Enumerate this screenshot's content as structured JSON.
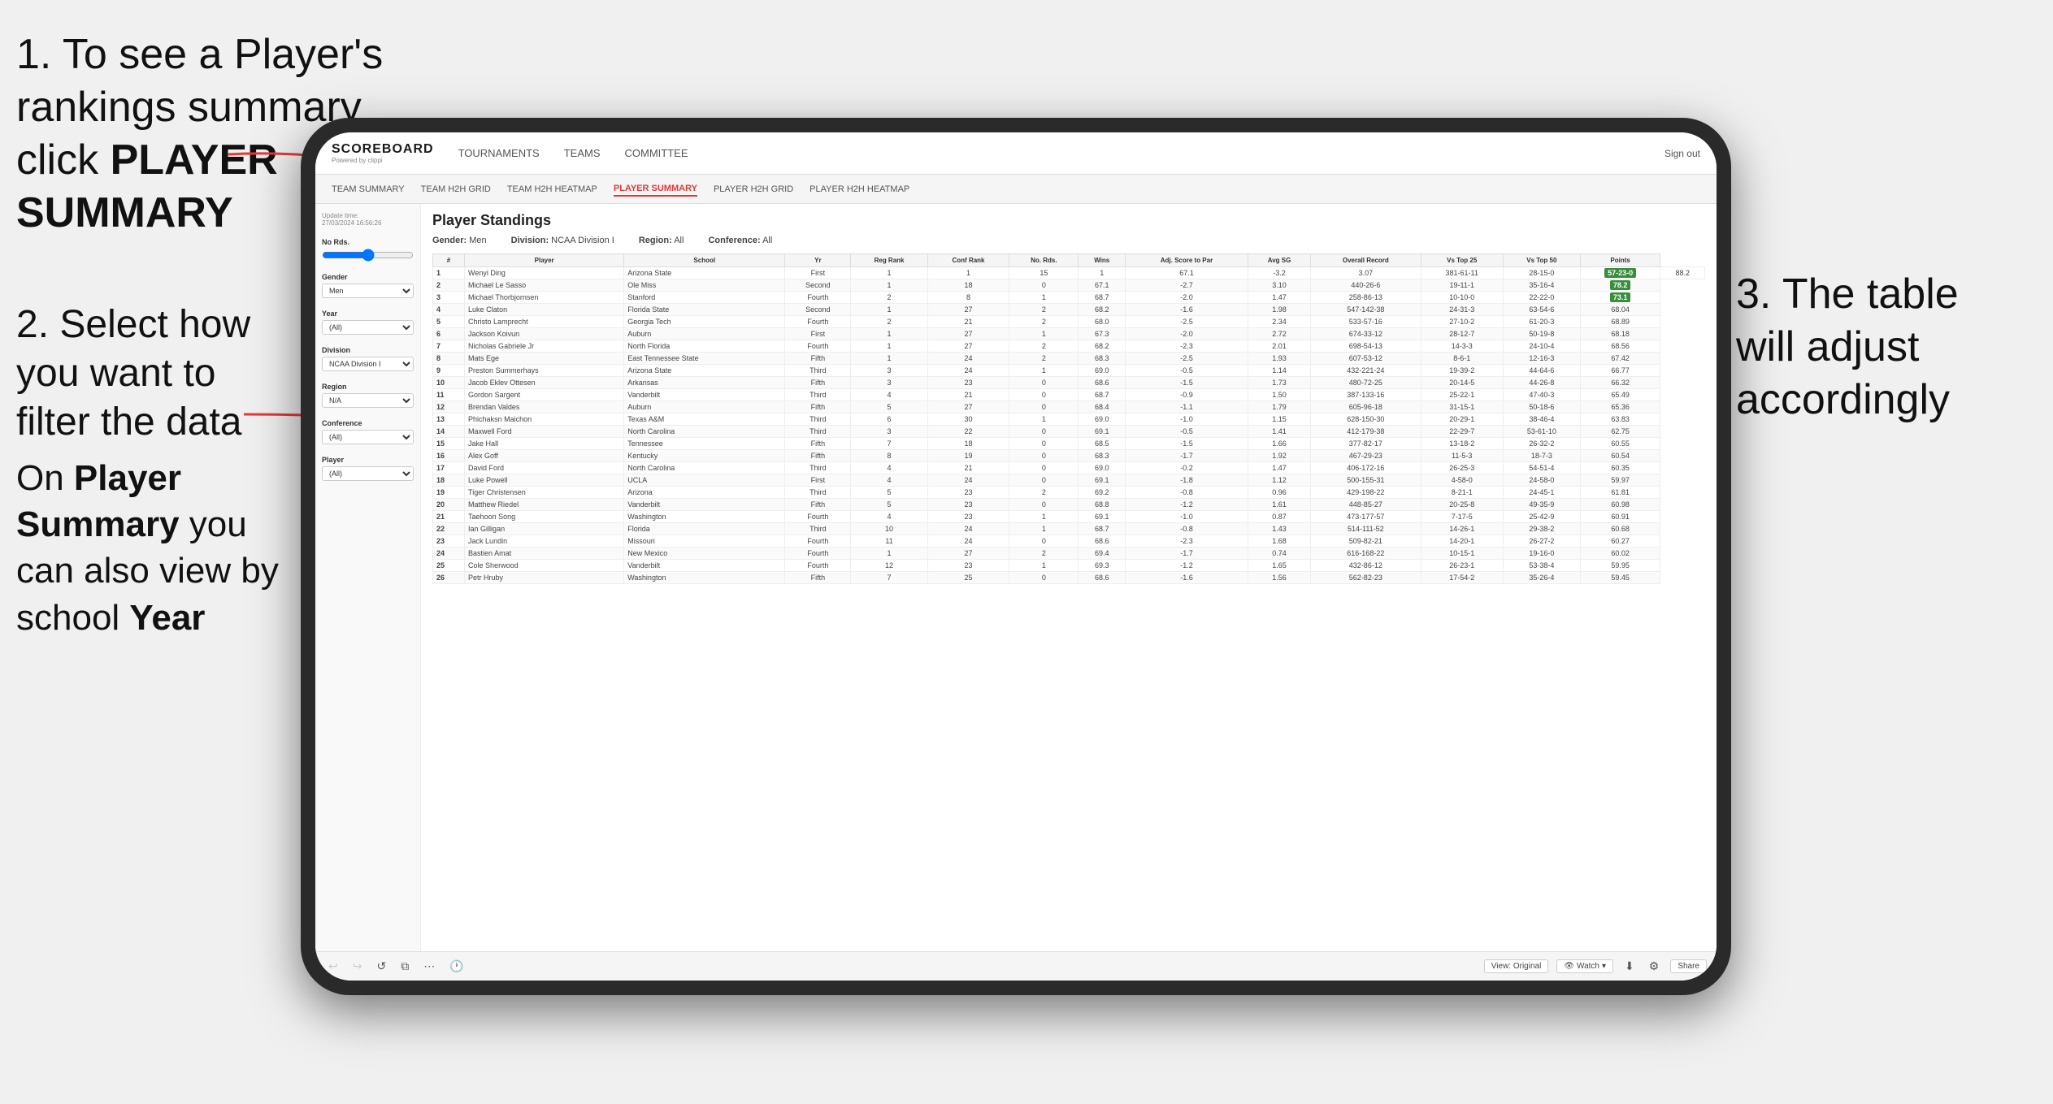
{
  "instructions": {
    "step1": "1. To see a Player's rankings summary click ",
    "step1_bold": "PLAYER SUMMARY",
    "step2_title": "2. Select how you want to filter the data",
    "step3_title": "3. The table will adjust accordingly",
    "bottom_note_pre": "On ",
    "bottom_note_bold1": "Player Summary",
    "bottom_note_mid": " you can also view by school ",
    "bottom_note_bold2": "Year"
  },
  "nav": {
    "logo": "SCOREBOARD",
    "logo_sub": "Powered by clippi",
    "items": [
      "TOURNAMENTS",
      "TEAMS",
      "COMMITTEE"
    ],
    "sign_out": "Sign out"
  },
  "sub_nav": {
    "items": [
      "TEAM SUMMARY",
      "TEAM H2H GRID",
      "TEAM H2H HEATMAP",
      "PLAYER SUMMARY",
      "PLAYER H2H GRID",
      "PLAYER H2H HEATMAP"
    ],
    "active": "PLAYER SUMMARY"
  },
  "sidebar": {
    "update_label": "Update time:",
    "update_time": "27/03/2024 16:56:26",
    "no_rds_label": "No Rds.",
    "gender_label": "Gender",
    "gender_value": "Men",
    "year_label": "Year",
    "year_value": "(All)",
    "division_label": "Division",
    "division_value": "NCAA Division I",
    "region_label": "Region",
    "region_value": "N/A",
    "conference_label": "Conference",
    "conference_value": "(All)",
    "player_label": "Player",
    "player_value": "(All)"
  },
  "table": {
    "title": "Player Standings",
    "filters": {
      "gender_label": "Gender:",
      "gender_value": "Men",
      "division_label": "Division:",
      "division_value": "NCAA Division I",
      "region_label": "Region:",
      "region_value": "All",
      "conference_label": "Conference:",
      "conference_value": "All"
    },
    "columns": [
      "#",
      "Player",
      "School",
      "Yr",
      "Reg Rank",
      "Conf Rank",
      "No. Rds.",
      "Wins",
      "Adj. Score to Par",
      "Avg SG",
      "Overall Record",
      "Vs Top 25",
      "Vs Top 50",
      "Points"
    ],
    "rows": [
      [
        "1",
        "Wenyi Ding",
        "Arizona State",
        "First",
        "1",
        "1",
        "15",
        "1",
        "67.1",
        "-3.2",
        "3.07",
        "381-61-11",
        "28-15-0",
        "57-23-0",
        "88.2"
      ],
      [
        "2",
        "Michael Le Sasso",
        "Ole Miss",
        "Second",
        "1",
        "18",
        "0",
        "67.1",
        "-2.7",
        "3.10",
        "440-26-6",
        "19-11-1",
        "35-16-4",
        "78.2"
      ],
      [
        "3",
        "Michael Thorbjornsen",
        "Stanford",
        "Fourth",
        "2",
        "8",
        "1",
        "68.7",
        "-2.0",
        "1.47",
        "258-86-13",
        "10-10-0",
        "22-22-0",
        "73.1"
      ],
      [
        "4",
        "Luke Claton",
        "Florida State",
        "Second",
        "1",
        "27",
        "2",
        "68.2",
        "-1.6",
        "1.98",
        "547-142-38",
        "24-31-3",
        "63-54-6",
        "68.04"
      ],
      [
        "5",
        "Christo Lamprecht",
        "Georgia Tech",
        "Fourth",
        "2",
        "21",
        "2",
        "68.0",
        "-2.5",
        "2.34",
        "533-57-16",
        "27-10-2",
        "61-20-3",
        "68.89"
      ],
      [
        "6",
        "Jackson Koivun",
        "Auburn",
        "First",
        "1",
        "27",
        "1",
        "67.3",
        "-2.0",
        "2.72",
        "674-33-12",
        "28-12-7",
        "50-19-8",
        "68.18"
      ],
      [
        "7",
        "Nicholas Gabriele Jr",
        "North Florida",
        "Fourth",
        "1",
        "27",
        "2",
        "68.2",
        "-2.3",
        "2.01",
        "698-54-13",
        "14-3-3",
        "24-10-4",
        "68.56"
      ],
      [
        "8",
        "Mats Ege",
        "East Tennessee State",
        "Fifth",
        "1",
        "24",
        "2",
        "68.3",
        "-2.5",
        "1.93",
        "607-53-12",
        "8-6-1",
        "12-16-3",
        "67.42"
      ],
      [
        "9",
        "Preston Summerhays",
        "Arizona State",
        "Third",
        "3",
        "24",
        "1",
        "69.0",
        "-0.5",
        "1.14",
        "432-221-24",
        "19-39-2",
        "44-64-6",
        "66.77"
      ],
      [
        "10",
        "Jacob Eklev Ottesen",
        "Arkansas",
        "Fifth",
        "3",
        "23",
        "0",
        "68.6",
        "-1.5",
        "1.73",
        "480-72-25",
        "20-14-5",
        "44-26-8",
        "66.32"
      ],
      [
        "11",
        "Gordon Sargent",
        "Vanderbilt",
        "Third",
        "4",
        "21",
        "0",
        "68.7",
        "-0.9",
        "1.50",
        "387-133-16",
        "25-22-1",
        "47-40-3",
        "65.49"
      ],
      [
        "12",
        "Brendan Valdes",
        "Auburn",
        "Fifth",
        "5",
        "27",
        "0",
        "68.4",
        "-1.1",
        "1.79",
        "605-96-18",
        "31-15-1",
        "50-18-6",
        "65.36"
      ],
      [
        "13",
        "Phichaksn Maichon",
        "Texas A&M",
        "Third",
        "6",
        "30",
        "1",
        "69.0",
        "-1.0",
        "1.15",
        "628-150-30",
        "20-29-1",
        "38-46-4",
        "63.83"
      ],
      [
        "14",
        "Maxwell Ford",
        "North Carolina",
        "Third",
        "3",
        "22",
        "0",
        "69.1",
        "-0.5",
        "1.41",
        "412-179-38",
        "22-29-7",
        "53-61-10",
        "62.75"
      ],
      [
        "15",
        "Jake Hall",
        "Tennessee",
        "Fifth",
        "7",
        "18",
        "0",
        "68.5",
        "-1.5",
        "1.66",
        "377-82-17",
        "13-18-2",
        "26-32-2",
        "60.55"
      ],
      [
        "16",
        "Alex Goff",
        "Kentucky",
        "Fifth",
        "8",
        "19",
        "0",
        "68.3",
        "-1.7",
        "1.92",
        "467-29-23",
        "11-5-3",
        "18-7-3",
        "60.54"
      ],
      [
        "17",
        "David Ford",
        "North Carolina",
        "Third",
        "4",
        "21",
        "0",
        "69.0",
        "-0.2",
        "1.47",
        "406-172-16",
        "26-25-3",
        "54-51-4",
        "60.35"
      ],
      [
        "18",
        "Luke Powell",
        "UCLA",
        "First",
        "4",
        "24",
        "0",
        "69.1",
        "-1.8",
        "1.12",
        "500-155-31",
        "4-58-0",
        "24-58-0",
        "59.97"
      ],
      [
        "19",
        "Tiger Christensen",
        "Arizona",
        "Third",
        "5",
        "23",
        "2",
        "69.2",
        "-0.8",
        "0.96",
        "429-198-22",
        "8-21-1",
        "24-45-1",
        "61.81"
      ],
      [
        "20",
        "Matthew Riedel",
        "Vanderbilt",
        "Fifth",
        "5",
        "23",
        "0",
        "68.8",
        "-1.2",
        "1.61",
        "448-85-27",
        "20-25-8",
        "49-35-9",
        "60.98"
      ],
      [
        "21",
        "Taehoon Song",
        "Washington",
        "Fourth",
        "4",
        "23",
        "1",
        "69.1",
        "-1.0",
        "0.87",
        "473-177-57",
        "7-17-5",
        "25-42-9",
        "60.91"
      ],
      [
        "22",
        "Ian Gilligan",
        "Florida",
        "Third",
        "10",
        "24",
        "1",
        "68.7",
        "-0.8",
        "1.43",
        "514-111-52",
        "14-26-1",
        "29-38-2",
        "60.68"
      ],
      [
        "23",
        "Jack Lundin",
        "Missouri",
        "Fourth",
        "11",
        "24",
        "0",
        "68.6",
        "-2.3",
        "1.68",
        "509-82-21",
        "14-20-1",
        "26-27-2",
        "60.27"
      ],
      [
        "24",
        "Bastien Amat",
        "New Mexico",
        "Fourth",
        "1",
        "27",
        "2",
        "69.4",
        "-1.7",
        "0.74",
        "616-168-22",
        "10-15-1",
        "19-16-0",
        "60.02"
      ],
      [
        "25",
        "Cole Sherwood",
        "Vanderbilt",
        "Fourth",
        "12",
        "23",
        "1",
        "69.3",
        "-1.2",
        "1.65",
        "432-86-12",
        "26-23-1",
        "53-38-4",
        "59.95"
      ],
      [
        "26",
        "Petr Hruby",
        "Washington",
        "Fifth",
        "7",
        "25",
        "0",
        "68.6",
        "-1.6",
        "1.56",
        "562-82-23",
        "17-54-2",
        "35-26-4",
        "59.45"
      ]
    ]
  },
  "toolbar": {
    "view_label": "View: Original",
    "watch_label": "Watch",
    "share_label": "Share"
  }
}
